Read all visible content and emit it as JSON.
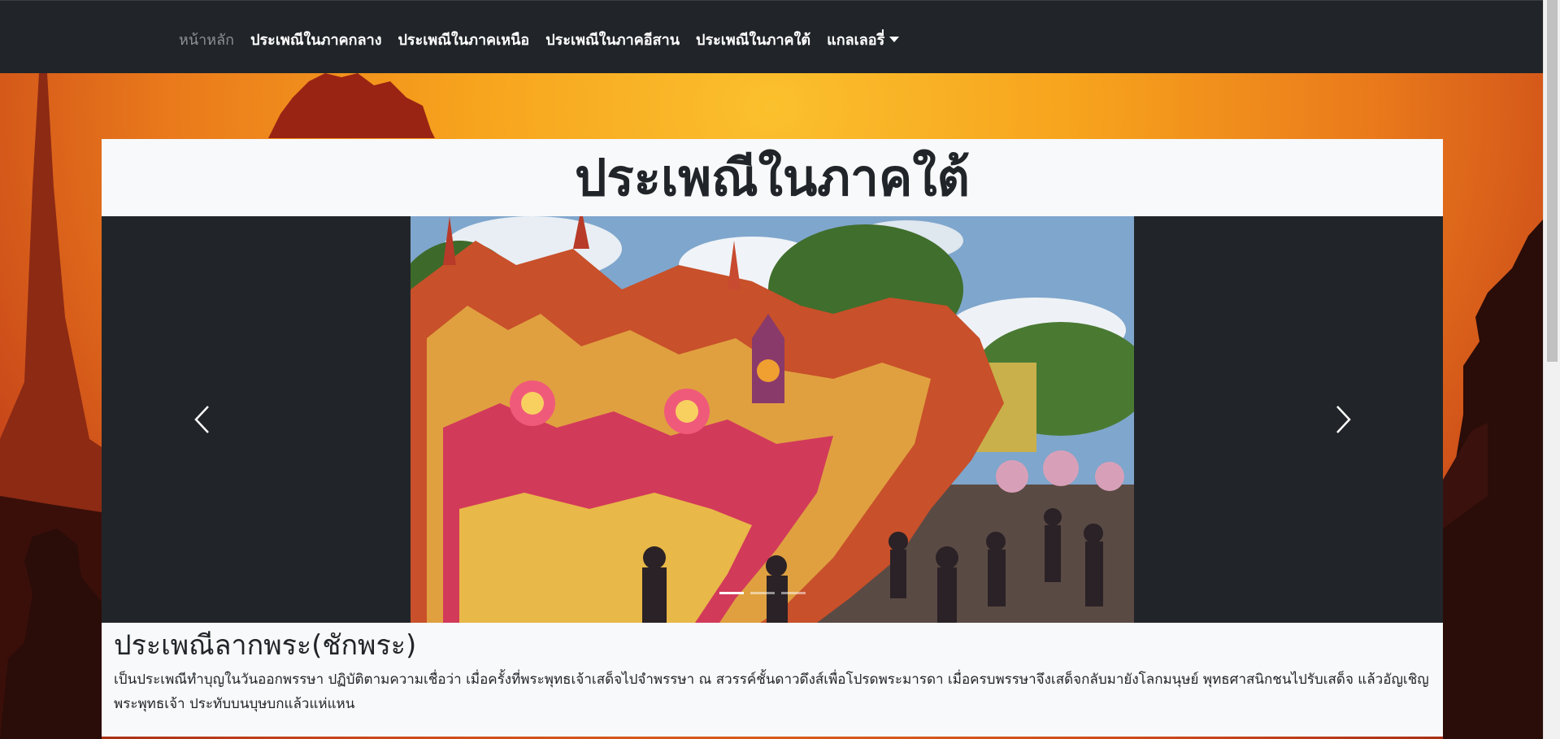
{
  "nav": {
    "items": [
      {
        "label": "หน้าหลัก",
        "active": true
      },
      {
        "label": "ประเพณีในภาคกลาง",
        "active": false
      },
      {
        "label": "ประเพณีในภาคเหนือ",
        "active": false
      },
      {
        "label": "ประเพณีในภาคอีสาน",
        "active": false
      },
      {
        "label": "ประเพณีในภาคใต้",
        "active": false
      },
      {
        "label": "แกลเลอรี่",
        "active": false,
        "dropdown": true
      }
    ]
  },
  "page": {
    "title": "ประเพณีในภาคใต้"
  },
  "carousel": {
    "prev_icon": "chevron-left-icon",
    "next_icon": "chevron-right-icon",
    "slide_count": 3,
    "active_slide": 1,
    "image": "thai-procession-float-photo"
  },
  "article": {
    "heading": "ประเพณีลากพระ(ชักพระ)",
    "body": "เป็นประเพณีทำบุญในวันออกพรรษา ปฏิบัติตามความเชื่อว่า เมื่อครั้งที่พระพุทธเจ้าเสด็จไปจำพรรษา ณ สวรรค์ชั้นดาวดึงส์เพื่อโปรดพระมารดา เมื่อครบพรรษาจึงเสด็จกลับมายังโลกมนุษย์ พุทธศาสนิกชนไปรับเสด็จ แล้วอัญเชิญพระพุทธเจ้า ประทับบนบุษบกแล้วแห่แหน"
  },
  "colors": {
    "navbar": "#212529",
    "page_bg": "#f8f9fa",
    "accent_orange": "#f7a31d"
  }
}
